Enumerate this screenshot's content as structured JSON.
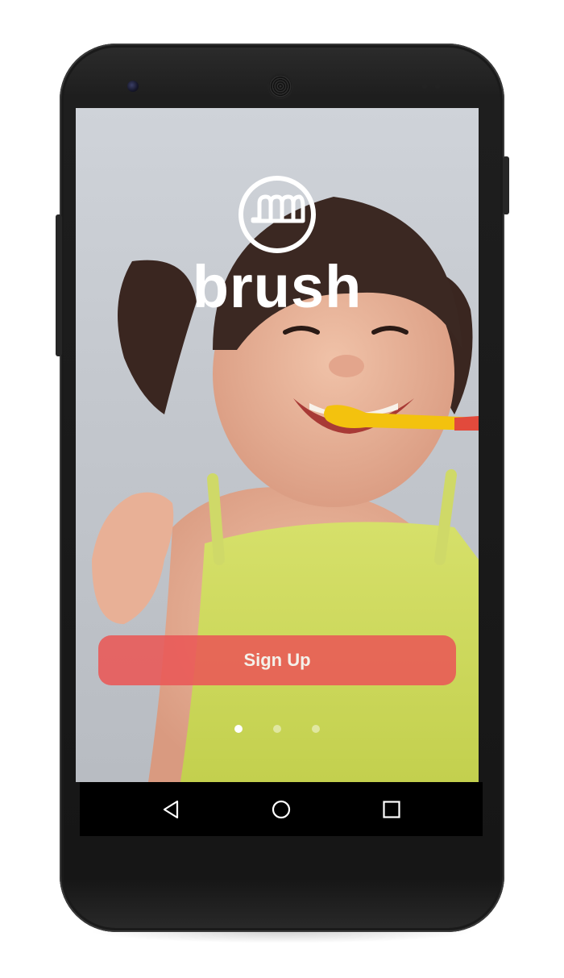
{
  "app": {
    "brand_name": "brush",
    "logo_icon": "brush-mouth-logo-icon"
  },
  "screen": {
    "background_photo": "child-brushing-teeth-photo",
    "signup_label": "Sign Up",
    "pager": {
      "total": 3,
      "active": 1
    }
  },
  "navbar": {
    "back_icon": "back-triangle-icon",
    "home_icon": "home-circle-icon",
    "recents_icon": "recents-square-icon"
  },
  "colors": {
    "signup_button": "#E95856",
    "brand_text": "#FFFFFF",
    "navbar": "#000000"
  }
}
